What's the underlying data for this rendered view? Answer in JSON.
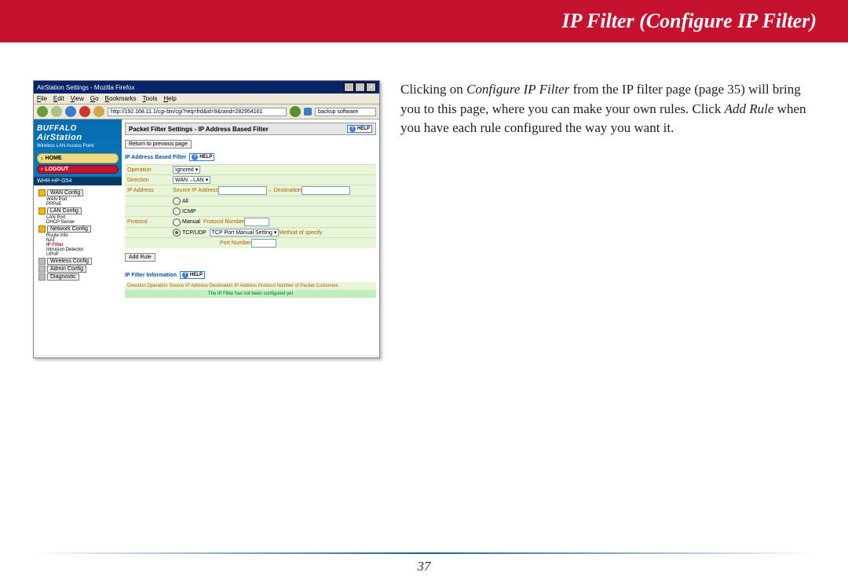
{
  "header": {
    "title": "IP Filter (Configure IP Filter)"
  },
  "page_number": "37",
  "desc": {
    "t1": "Clicking on ",
    "t2": "Configure IP Filter",
    "t3": " from the IP filter page (page 35) will bring you to this page, where you can make your own rules.  Click ",
    "t4": "Add Rule",
    "t5": " when you have each rule configured the way you want it."
  },
  "screenshot": {
    "window_title": "AirStation Settings - Mozilla Firefox",
    "menu": [
      "File",
      "Edit",
      "View",
      "Go",
      "Bookmarks",
      "Tools",
      "Help"
    ],
    "url": "http://192.168.11.1/cgi-bin/cgi?req=frd&id=9&rand=282954161",
    "search": "backup software",
    "brand1": "BUFFALO",
    "brand2": "AirStation",
    "brand_sub": "Wireless LAN Access Point",
    "home": "HOME",
    "logout": "LOGOUT",
    "model": "WHR-HP-G54",
    "nav": {
      "wan": "WAN Config",
      "wanport": "WAN Port",
      "pppoe": "PPPoE",
      "lan": "LAN Config",
      "lanport": "LAN Port",
      "dhcp": "DHCP Server",
      "net": "Network Config",
      "route": "Route Info",
      "nat": "NAT",
      "ipfilter": "IP Filter",
      "intr": "Intrusion Detector",
      "upnp": "UPnP",
      "wireless": "Wireless Config",
      "admin": "Admin Config",
      "diag": "Diagnostic"
    },
    "main": {
      "title": "Packet Filter Settings - IP Address Based Filter",
      "help": "HELP",
      "return": "Return to previous page",
      "sect1": "IP Address Based Filter",
      "op_label": "Operation",
      "op_val": "Ignored",
      "dir_label": "Direction",
      "dir_val": "WAN→LAN",
      "ip_label": "IP Address",
      "ip_src": "Source IP Address",
      "ip_dst": "→ Destination",
      "proto_label": "Protocol",
      "proto_all": "All",
      "proto_icmp": "ICMP",
      "proto_manual": "Manual",
      "proto_num": "Protocol Number",
      "proto_tcp": "TCP/UDP",
      "proto_port": "TCP Port Manual Setting",
      "proto_meth": "Method of specify",
      "proto_pn": "Port Number",
      "add": "Add Rule",
      "sect2": "IP Filter Information",
      "thdr": "Direction Operation Source IP Address Destination IP Address Protocol Number of Packet Customize",
      "tmsg": "The IP Filter has not been configured yet"
    }
  }
}
